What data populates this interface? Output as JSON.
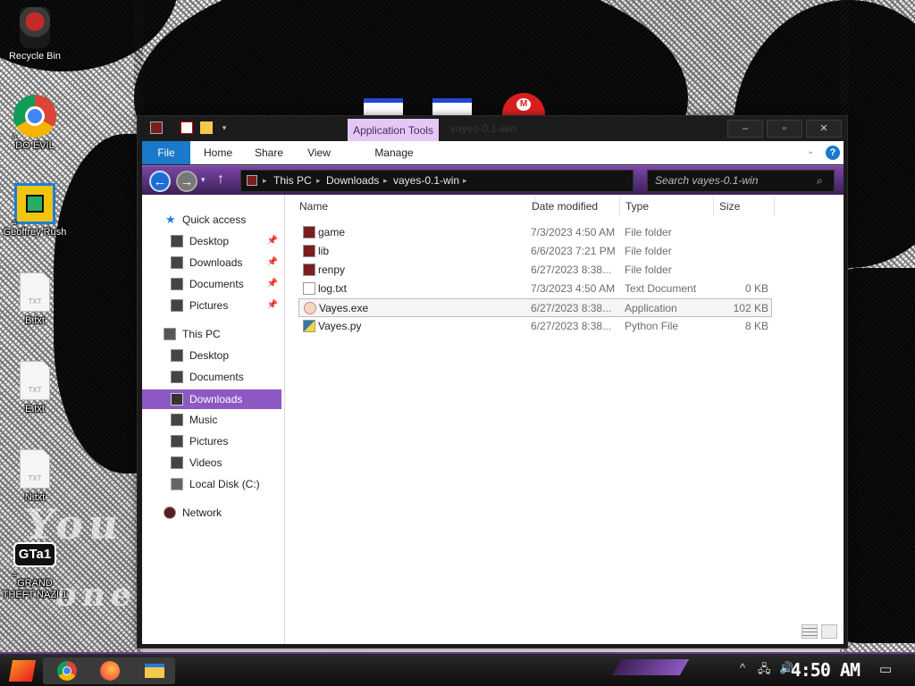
{
  "desktop": {
    "icons": [
      {
        "label": "Recycle Bin"
      },
      {
        "label": "DO EVIL"
      },
      {
        "label": "Geoffrey Rush"
      },
      {
        "label": "B.txt",
        "badge": "TXT"
      },
      {
        "label": "E.txt",
        "badge": "TXT"
      },
      {
        "label": "N.txt",
        "badge": "TXT"
      },
      {
        "label": "GRAND THEFT NAZI 1",
        "logo": "GTa1"
      }
    ],
    "wallpaper_text_1": "You s",
    "wallpaper_text_2": "one"
  },
  "window": {
    "title": "vayes-0.1-win",
    "contextual_tab": "Application Tools",
    "controls": {
      "minimize": "–",
      "maximize": "▫",
      "close": "✕"
    },
    "ribbon": {
      "tabs": [
        "File",
        "Home",
        "Share",
        "View",
        "Manage"
      ],
      "collapse_icon": "chevron-down-icon",
      "help": "?"
    },
    "breadcrumb": [
      "This PC",
      "Downloads",
      "vayes-0.1-win"
    ],
    "search_placeholder": "Search vayes-0.1-win",
    "nav": {
      "quick_access": "Quick access",
      "quick_items": [
        "Desktop",
        "Downloads",
        "Documents",
        "Pictures"
      ],
      "this_pc": "This PC",
      "pc_items": [
        "Desktop",
        "Documents",
        "Downloads",
        "Music",
        "Pictures",
        "Videos",
        "Local Disk (C:)"
      ],
      "network": "Network",
      "selected": "Downloads"
    },
    "columns": [
      "Name",
      "Date modified",
      "Type",
      "Size"
    ],
    "files": [
      {
        "name": "game",
        "date": "7/3/2023 4:50 AM",
        "type": "File folder",
        "size": "",
        "icon": "folder-icon"
      },
      {
        "name": "lib",
        "date": "6/6/2023 7:21 PM",
        "type": "File folder",
        "size": "",
        "icon": "folder-icon"
      },
      {
        "name": "renpy",
        "date": "6/27/2023 8:38...",
        "type": "File folder",
        "size": "",
        "icon": "folder-icon"
      },
      {
        "name": "log.txt",
        "date": "7/3/2023 4:50 AM",
        "type": "Text Document",
        "size": "0 KB",
        "icon": "text-file-icon"
      },
      {
        "name": "Vayes.exe",
        "date": "6/27/2023 8:38...",
        "type": "Application",
        "size": "102 KB",
        "icon": "app-icon"
      },
      {
        "name": "Vayes.py",
        "date": "6/27/2023 8:38...",
        "type": "Python File",
        "size": "8 KB",
        "icon": "python-file-icon"
      }
    ],
    "selected_file": "Vayes.exe"
  },
  "taskbar": {
    "pinned": [
      "start-icon",
      "chrome-icon",
      "firefox-icon",
      "file-explorer-icon"
    ],
    "clock": "4:50 AM",
    "tray": {
      "show_hidden": "^",
      "network": "network-icon",
      "volume": "speaker-icon",
      "notifications": "notification-icon"
    }
  },
  "colors": {
    "accent": "#8d58c2",
    "ribbon_file": "#1979ca",
    "contextual": "#e3c8f5"
  }
}
